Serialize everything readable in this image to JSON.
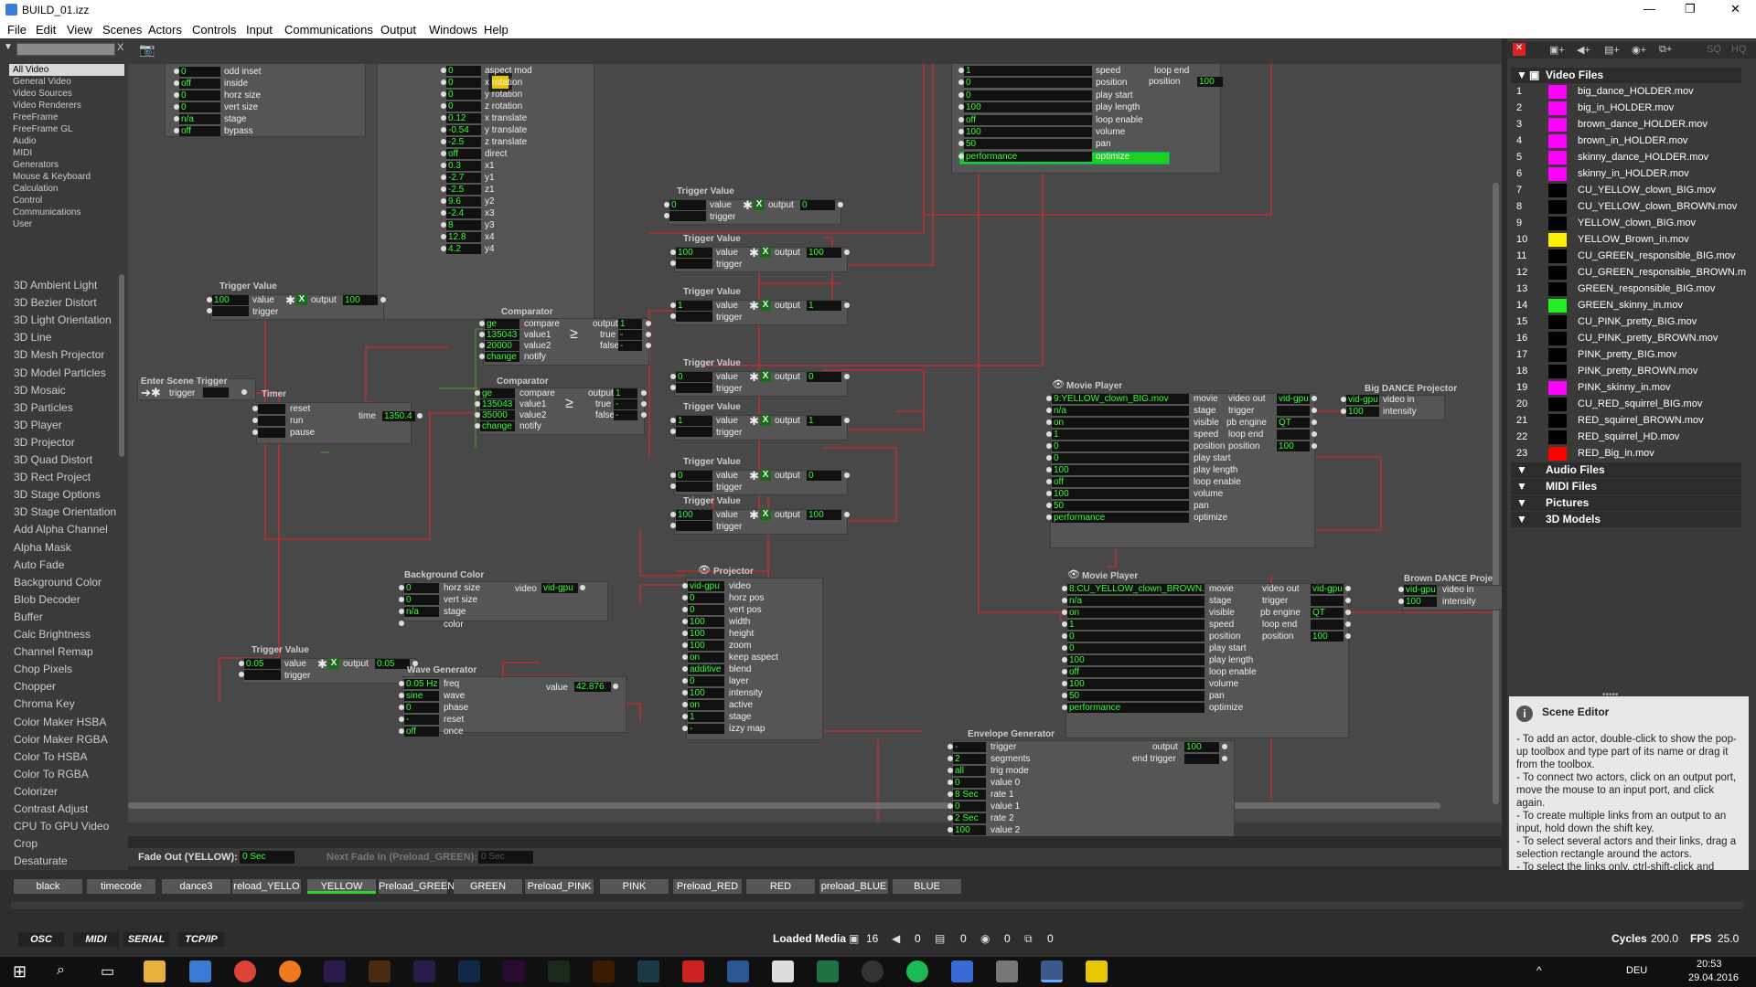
{
  "window": {
    "title": "BUILD_01.izz",
    "minimize": "—",
    "maximize": "❐",
    "close": "✕"
  },
  "menu": [
    "File",
    "Edit",
    "View",
    "Scenes",
    "Actors",
    "Controls",
    "Input",
    "Communications",
    "Output",
    "Windows",
    "Help"
  ],
  "left": {
    "search_clear": "X",
    "categories": [
      "All Video",
      "General Video",
      "Video Sources",
      "Video Renderers",
      "FreeFrame",
      "FreeFrame GL",
      "Audio",
      "MIDI",
      "Generators",
      "Mouse & Keyboard",
      "Calculation",
      "Control",
      "Communications",
      "User"
    ],
    "actors": [
      "3D Ambient Light",
      "3D Bezier Distort",
      "3D Light Orientation",
      "3D Line",
      "3D Mesh Projector",
      "3D Model Particles",
      "3D Mosaic",
      "3D Particles",
      "3D Player",
      "3D Projector",
      "3D Quad Distort",
      "3D Rect Project",
      "3D Stage Options",
      "3D Stage Orientation",
      "Add Alpha Channel",
      "Alpha Mask",
      "Auto Fade",
      "Background Color",
      "Blob Decoder",
      "Buffer",
      "Calc Brightness",
      "Channel Remap",
      "Chop Pixels",
      "Chopper",
      "Chroma Key",
      "Color Maker HSBA",
      "Color Maker RGBA",
      "Color To HSBA",
      "Color To RGBA",
      "Colorizer",
      "Contrast Adjust",
      "CPU To GPU Video",
      "Crop",
      "Desaturate"
    ]
  },
  "nodes": {
    "topleft": {
      "rows": [
        [
          "0",
          "odd inset"
        ],
        [
          "off",
          "inside"
        ],
        [
          "0",
          "horz size"
        ],
        [
          "0",
          "vert size"
        ],
        [
          "n/a",
          "stage"
        ],
        [
          "off",
          "bypass"
        ]
      ]
    },
    "rotation": {
      "rows": [
        [
          "0",
          "aspect mod"
        ],
        [
          "0",
          "x rotation"
        ],
        [
          "0",
          "y rotation"
        ],
        [
          "0",
          "z rotation"
        ],
        [
          "0.12",
          "x translate"
        ],
        [
          "-0.54",
          "y translate"
        ],
        [
          "-2.5",
          "z translate"
        ],
        [
          "off",
          "direct"
        ],
        [
          "0.3",
          "x1"
        ],
        [
          "-2.7",
          "y1"
        ],
        [
          "-2.5",
          "z1"
        ],
        [
          "9.6",
          "y2"
        ],
        [
          "-2.4",
          "x3"
        ],
        [
          "8",
          "y3"
        ],
        [
          "12.8",
          "x4"
        ],
        [
          "4.2",
          "y4"
        ]
      ]
    },
    "movie_top": {
      "rows": [
        [
          "1",
          "speed"
        ],
        [
          "0",
          "position"
        ],
        [
          "0",
          "play start"
        ],
        [
          "100",
          "play length"
        ],
        [
          "off",
          "loop enable"
        ],
        [
          "100",
          "volume"
        ],
        [
          "50",
          "pan"
        ],
        [
          "performance",
          "optimize"
        ]
      ],
      "right": [
        [
          "loop end",
          "",
          ""
        ],
        [
          "position",
          "100"
        ]
      ]
    },
    "tv_main": {
      "title": "Trigger Value",
      "value": "100",
      "output": "100"
    },
    "tv1": {
      "title": "Trigger Value",
      "value": "0",
      "output": "0"
    },
    "tv2": {
      "title": "Trigger Value",
      "value": "100",
      "output": "100"
    },
    "tv3": {
      "title": "Trigger Value",
      "value": "1",
      "output": "1"
    },
    "tv4": {
      "title": "Trigger Value",
      "value": "0",
      "output": "0"
    },
    "tv5": {
      "title": "Trigger Value",
      "value": "1",
      "output": "1"
    },
    "tv6": {
      "title": "Trigger Value",
      "value": "0",
      "output": "0"
    },
    "tv7": {
      "title": "Trigger Value",
      "value": "100",
      "output": "100"
    },
    "tv8": {
      "title": "Trigger Value",
      "value": "0.05",
      "output": "0.05"
    },
    "comp1": {
      "title": "Comparator",
      "compare": "ge",
      "value1": "135043",
      "value2": "20000",
      "change": "change",
      "output": "1",
      "true": "-",
      "false": "-"
    },
    "comp2": {
      "title": "Comparator",
      "compare": "ge",
      "value1": "135043",
      "value2": "35000",
      "change": "change",
      "output": "1",
      "true": "-",
      "false": "-"
    },
    "enter": {
      "title": "Enter Scene Trigger",
      "trigger": "trigger"
    },
    "timer": {
      "title": "Timer",
      "time": "1350.4"
    },
    "bgcolor": {
      "title": "Background Color",
      "horz": "0",
      "vert": "0",
      "stage": "n/a",
      "video": "vid-gpu"
    },
    "projector": {
      "title": "Projector",
      "rows": [
        [
          "vid-gpu",
          "video"
        ],
        [
          "0",
          "horz pos"
        ],
        [
          "0",
          "vert pos"
        ],
        [
          "100",
          "width"
        ],
        [
          "100",
          "height"
        ],
        [
          "100",
          "zoom"
        ],
        [
          "on",
          "keep aspect"
        ],
        [
          "additive",
          "blend"
        ],
        [
          "0",
          "layer"
        ],
        [
          "100",
          "intensity"
        ],
        [
          "on",
          "active"
        ],
        [
          "1",
          "stage"
        ],
        [
          "-",
          "izzy map"
        ]
      ]
    },
    "wave": {
      "title": "Wave Generator",
      "rows": [
        [
          "0.05 Hz",
          "freq"
        ],
        [
          "sine",
          "wave"
        ],
        [
          "0",
          "phase"
        ],
        [
          "-",
          "reset"
        ],
        [
          "off",
          "once"
        ]
      ],
      "value": "42.876"
    },
    "movie1": {
      "title": "Movie Player",
      "rows": [
        [
          "9:YELLOW_clown_BIG.mov",
          "movie"
        ],
        [
          "n/a",
          "stage"
        ],
        [
          "on",
          "visible"
        ],
        [
          "1",
          "speed"
        ],
        [
          "0",
          "position"
        ],
        [
          "0",
          "play start"
        ],
        [
          "100",
          "play length"
        ],
        [
          "off",
          "loop enable"
        ],
        [
          "100",
          "volume"
        ],
        [
          "50",
          "pan"
        ],
        [
          "performance",
          "optimize"
        ]
      ],
      "outs": [
        [
          "video out",
          "vid-gpu"
        ],
        [
          "trigger",
          ""
        ],
        [
          "pb engine",
          "QT"
        ],
        [
          "loop end",
          ""
        ],
        [
          "position",
          "100"
        ]
      ]
    },
    "movie2": {
      "title": "Movie Player",
      "rows": [
        [
          "8:CU_YELLOW_clown_BROWN.m",
          "movie"
        ],
        [
          "n/a",
          "stage"
        ],
        [
          "on",
          "visible"
        ],
        [
          "1",
          "speed"
        ],
        [
          "0",
          "position"
        ],
        [
          "0",
          "play start"
        ],
        [
          "100",
          "play length"
        ],
        [
          "off",
          "loop enable"
        ],
        [
          "100",
          "volume"
        ],
        [
          "50",
          "pan"
        ],
        [
          "performance",
          "optimize"
        ]
      ],
      "outs": [
        [
          "video out",
          "vid-gpu"
        ],
        [
          "trigger",
          ""
        ],
        [
          "pb engine",
          "QT"
        ],
        [
          "loop end",
          ""
        ],
        [
          "position",
          "100"
        ]
      ]
    },
    "bigproj": {
      "title": "Big DANCE Projector",
      "video": "vid-gpu",
      "intensity": "100"
    },
    "brownproj": {
      "title": "Brown DANCE Proje",
      "video": "vid-gpu",
      "intensity": "100"
    },
    "env": {
      "title": "Envelope Generator",
      "rows": [
        [
          "-",
          "trigger"
        ],
        [
          "2",
          "segments"
        ],
        [
          "all",
          "trig mode"
        ],
        [
          "0",
          "value 0"
        ],
        [
          "8 Sec",
          "rate 1"
        ],
        [
          "0",
          "value 1"
        ],
        [
          "2 Sec",
          "rate 2"
        ],
        [
          "100",
          "value 2"
        ]
      ],
      "output": "100",
      "end": "end trigger"
    }
  },
  "stage_bottom": {
    "fade_label": "Fade Out (YELLOW):",
    "fade_val": "0 Sec",
    "next_label": "Next Fade In (Preload_GREEN):",
    "next_val": "0 Sec"
  },
  "media": {
    "video_header": "Video Files",
    "files": [
      {
        "n": "1",
        "c": "#ff00ff",
        "name": "big_dance_HOLDER.mov"
      },
      {
        "n": "2",
        "c": "#ff00ff",
        "name": "big_in_HOLDER.mov"
      },
      {
        "n": "3",
        "c": "#ff00ff",
        "name": "brown_dance_HOLDER.mov"
      },
      {
        "n": "4",
        "c": "#ff00ff",
        "name": "brown_in_HOLDER.mov"
      },
      {
        "n": "5",
        "c": "#ff00ff",
        "name": "skinny_dance_HOLDER.mov"
      },
      {
        "n": "6",
        "c": "#ff00ff",
        "name": "skinny_in_HOLDER.mov"
      },
      {
        "n": "7",
        "c": "#000000",
        "name": "CU_YELLOW_clown_BIG.mov"
      },
      {
        "n": "8",
        "c": "#000000",
        "name": "CU_YELLOW_clown_BROWN.mov"
      },
      {
        "n": "9",
        "c": "#000000",
        "name": "YELLOW_clown_BIG.mov"
      },
      {
        "n": "10",
        "c": "#ffee00",
        "name": "YELLOW_Brown_in.mov"
      },
      {
        "n": "11",
        "c": "#000000",
        "name": "CU_GREEN_responsible_BIG.mov"
      },
      {
        "n": "12",
        "c": "#000000",
        "name": "CU_GREEN_responsible_BROWN.m"
      },
      {
        "n": "13",
        "c": "#000000",
        "name": "GREEN_responsible_BIG.mov"
      },
      {
        "n": "14",
        "c": "#22ee22",
        "name": "GREEN_skinny_in.mov"
      },
      {
        "n": "15",
        "c": "#000000",
        "name": "CU_PINK_pretty_BIG.mov"
      },
      {
        "n": "16",
        "c": "#000000",
        "name": "CU_PINK_pretty_BROWN.mov"
      },
      {
        "n": "17",
        "c": "#000000",
        "name": "PINK_pretty_BIG.mov"
      },
      {
        "n": "18",
        "c": "#000000",
        "name": "PINK_pretty_BROWN.mov"
      },
      {
        "n": "19",
        "c": "#ff00ff",
        "name": "PINK_skinny_in.mov"
      },
      {
        "n": "20",
        "c": "#000000",
        "name": "CU_RED_squirrel_BIG.mov"
      },
      {
        "n": "21",
        "c": "#000000",
        "name": "RED_squirrel_BROWN.mov"
      },
      {
        "n": "22",
        "c": "#000000",
        "name": "RED_squirrel_HD.mov"
      },
      {
        "n": "23",
        "c": "#ff0000",
        "name": "RED_Big_in.mov"
      }
    ],
    "sections": [
      "Audio Files",
      "MIDI Files",
      "Pictures",
      "3D Models"
    ],
    "toolbar_right": [
      "SQ",
      "HQ"
    ]
  },
  "scene_editor": {
    "title": "Scene Editor",
    "text": "- To add an actor, double-click to show the pop-up toolbox and type part of its name or drag it from the toolbox.\n- To connect two actors, click on an output port, move the mouse to an input port, and click again.\n- To create multiple links from an output to an input, hold down the shift key.\n- To select several actors and their links, drag a selection rectangle around the actors.\n- To select the links only, ctrl-shift-click and"
  },
  "scenes": [
    "black",
    "timecode",
    "dance3",
    "reload_YELLO",
    "YELLOW",
    "Preload_GREEN",
    "GREEN",
    "Preload_PINK",
    "PINK",
    "Preload_RED",
    "RED",
    "preload_BLUE",
    "BLUE"
  ],
  "active_scene": "YELLOW",
  "status": {
    "tabs": [
      "OSC",
      "MIDI",
      "SERIAL",
      "TCP/IP"
    ],
    "loaded": "Loaded Media",
    "m1": "16",
    "m2": "0",
    "m3": "0",
    "m4": "0",
    "m5": "0",
    "cycles_label": "Cycles",
    "cycles": "200.0",
    "fps_label": "FPS",
    "fps": "25.0"
  },
  "taskbar": {
    "lang": "DEU",
    "time": "20:53",
    "date": "29.04.2016"
  },
  "colors": {
    "accent_green": "#2bd52b",
    "wire": "#c03030"
  }
}
